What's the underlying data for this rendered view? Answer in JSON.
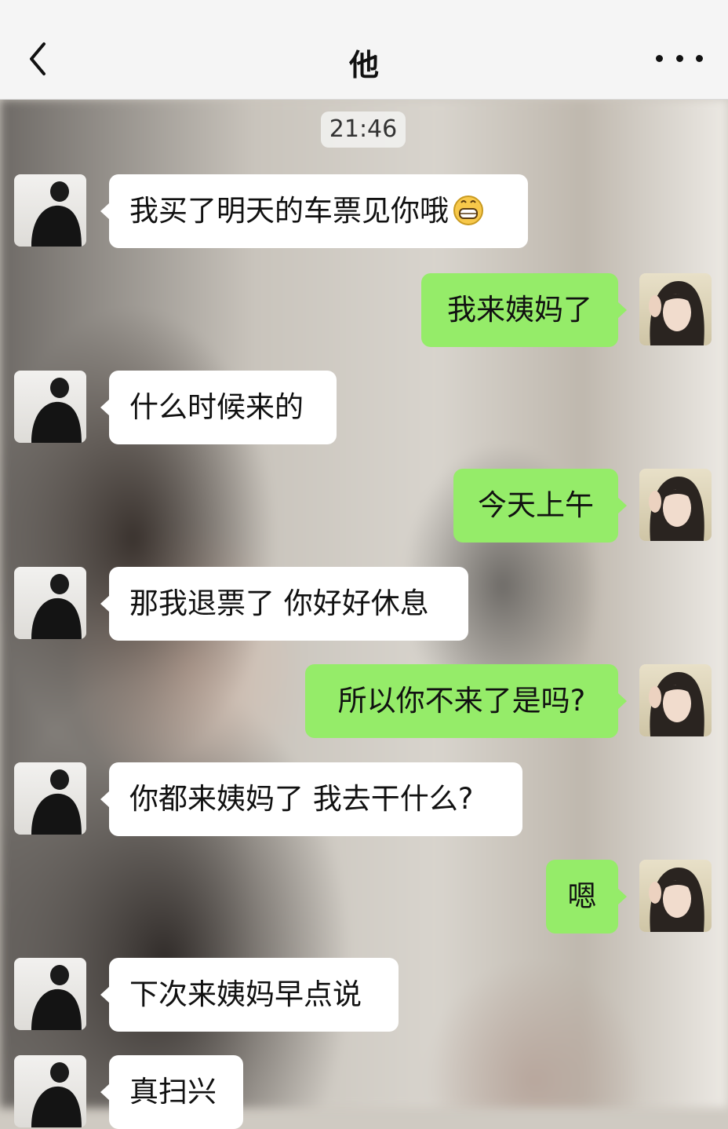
{
  "header": {
    "title": "他"
  },
  "timestamp": "21:46",
  "colors": {
    "sent_bubble": "#95ec69",
    "received_bubble": "#ffffff"
  },
  "messages": [
    {
      "sender": "him",
      "text": "我买了明天的车票见你哦",
      "emoji": "grinning-face-emoji"
    },
    {
      "sender": "me",
      "text": "我来姨妈了"
    },
    {
      "sender": "him",
      "text": "什么时候来的"
    },
    {
      "sender": "me",
      "text": "今天上午"
    },
    {
      "sender": "him",
      "text": "那我退票了 你好好休息"
    },
    {
      "sender": "me",
      "text": "所以你不来了是吗?"
    },
    {
      "sender": "him",
      "text": "你都来姨妈了 我去干什么?"
    },
    {
      "sender": "me",
      "text": "嗯"
    },
    {
      "sender": "him",
      "text": "下次来姨妈早点说"
    },
    {
      "sender": "him",
      "text": "真扫兴"
    }
  ]
}
